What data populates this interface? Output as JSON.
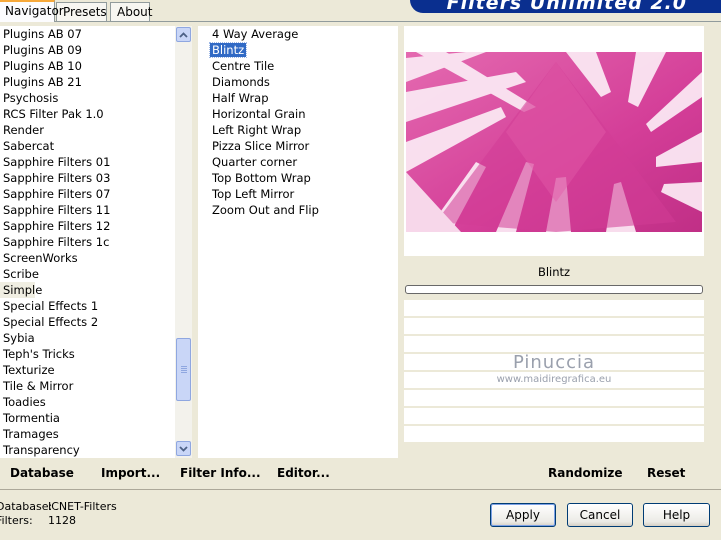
{
  "tabs": [
    {
      "label": "Navigator"
    },
    {
      "label": "Presets"
    },
    {
      "label": "About"
    }
  ],
  "banner": {
    "title": "Filters Unlimited 2.0",
    "color": "#0a2f8f"
  },
  "categories": [
    "Plugins AB 07",
    "Plugins AB 09",
    "Plugins AB 10",
    "Plugins AB 21",
    "Psychosis",
    "RCS Filter Pak 1.0",
    "Render",
    "Sabercat",
    "Sapphire Filters 01",
    "Sapphire Filters 03",
    "Sapphire Filters 07",
    "Sapphire Filters 11",
    "Sapphire Filters 12",
    "Sapphire Filters 1c",
    "ScreenWorks",
    "Scribe",
    "Simple",
    "Special Effects 1",
    "Special Effects 2",
    "Sybia",
    "Teph's Tricks",
    "Texturize",
    "Tile & Mirror",
    "Toadies",
    "Tormentia",
    "Tramages",
    "Transparency"
  ],
  "selected_category": "Simple",
  "filters": [
    "4 Way Average",
    "Blintz",
    "Centre Tile",
    "Diamonds",
    "Half Wrap",
    "Horizontal Grain",
    "Left Right Wrap",
    "Pizza Slice Mirror",
    "Quarter corner",
    "Top Bottom Wrap",
    "Top Left Mirror",
    "Zoom Out and Flip"
  ],
  "selected_filter": "Blintz",
  "preview": {
    "filter_name": "Blintz",
    "accent": "#d8449a",
    "watermark_name": "Pinuccia",
    "watermark_url": "www.maidiregrafica.eu"
  },
  "commands_left": {
    "database": "Database",
    "import": "Import...",
    "filter_info": "Filter Info...",
    "editor": "Editor..."
  },
  "commands_right": {
    "randomize": "Randomize",
    "reset": "Reset"
  },
  "status": {
    "database_label": "Database:",
    "database_value": "ICNET-Filters",
    "filters_label": "Filters:",
    "filters_value": "1128"
  },
  "buttons": {
    "apply": "Apply",
    "cancel": "Cancel",
    "help": "Help"
  }
}
